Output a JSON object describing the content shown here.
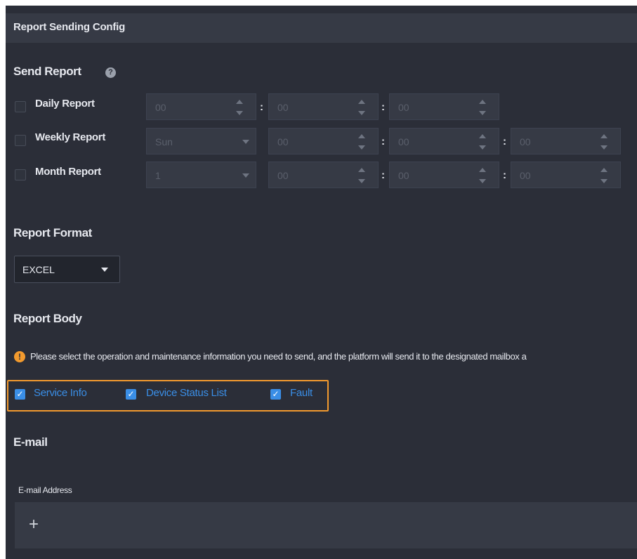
{
  "header": {
    "title": "Report Sending Config"
  },
  "send_report": {
    "title": "Send Report",
    "help_icon": "question-circle-icon",
    "rows": [
      {
        "label": "Daily Report",
        "checked": false,
        "select": null,
        "fields": [
          "00",
          "00",
          "00"
        ]
      },
      {
        "label": "Weekly Report",
        "checked": false,
        "select": "Sun",
        "fields": [
          "00",
          "00",
          "00"
        ]
      },
      {
        "label": "Month Report",
        "checked": false,
        "select": "1",
        "fields": [
          "00",
          "00",
          "00"
        ]
      }
    ]
  },
  "report_format": {
    "title": "Report Format",
    "value": "EXCEL"
  },
  "report_body": {
    "title": "Report Body",
    "notice_icon": "warning-circle-icon",
    "notice": "Please select the operation and maintenance information you need to send, and the platform will send it to the designated mailbox a",
    "options": [
      {
        "label": "Service Info",
        "checked": true
      },
      {
        "label": "Device Status List",
        "checked": true
      },
      {
        "label": "Fault",
        "checked": true
      }
    ],
    "accent": "#3a8ee6",
    "highlight": "#f29a2e"
  },
  "email": {
    "title": "E-mail",
    "address_label": "E-mail Address",
    "add_icon": "plus-icon"
  }
}
